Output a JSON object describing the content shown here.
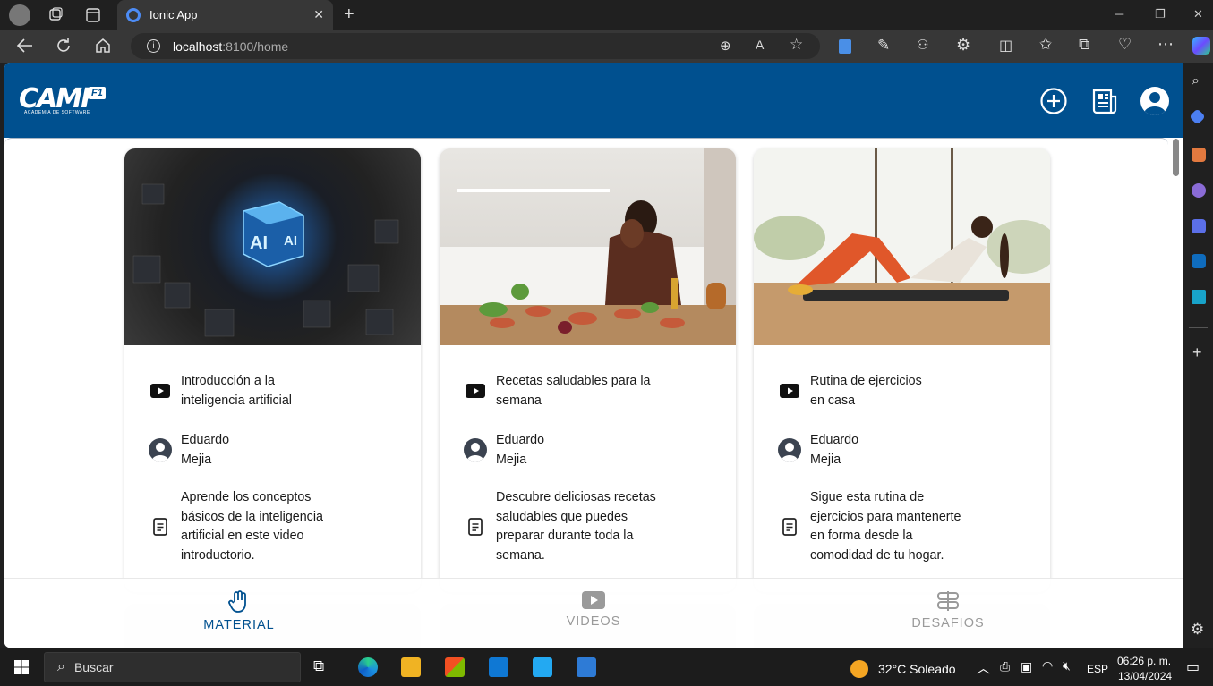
{
  "browser": {
    "tab_title": "Ionic App",
    "url_host": "localhost",
    "url_path": ":8100/home"
  },
  "app": {
    "logo_text": "CAMF",
    "logo_badge": "F1",
    "logo_subtitle": "ACADEMIA DE SOFTWARE",
    "toolbar_icons": [
      "add-circle-icon",
      "newspaper-icon",
      "person-circle-icon"
    ],
    "cards": [
      {
        "title": "Introducción a la\ninteligencia artificial",
        "author": "Eduardo\nMejia",
        "description": "Aprende los conceptos\nbásicos de la inteligencia\nartificial en este video\nintroductorio."
      },
      {
        "title": "Recetas saludables para la\nsemana",
        "author": "Eduardo\nMejia",
        "description": "Descubre deliciosas recetas\nsaludables que puedes\npreparar durante toda la\nsemana."
      },
      {
        "title": "Rutina de ejercicios\nen casa",
        "author": "Eduardo\nMejia",
        "description": "Sigue esta rutina de\nejercicios para mantenerte\nen forma desde la\ncomodidad de tu hogar."
      }
    ],
    "tabs": [
      {
        "label": "MATERIAL",
        "icon": "hand-icon",
        "active": true
      },
      {
        "label": "VIDEOS",
        "icon": "play-icon",
        "active": false
      },
      {
        "label": "DESAFIOS",
        "icon": "signpost-icon",
        "active": false
      }
    ],
    "colors": {
      "primary": "#00508f",
      "inactive": "#9a9a9a"
    }
  },
  "taskbar": {
    "search_placeholder": "Buscar",
    "weather": "32°C  Soleado",
    "language": "ESP",
    "time": "06:26 p. m.",
    "date": "13/04/2024"
  }
}
